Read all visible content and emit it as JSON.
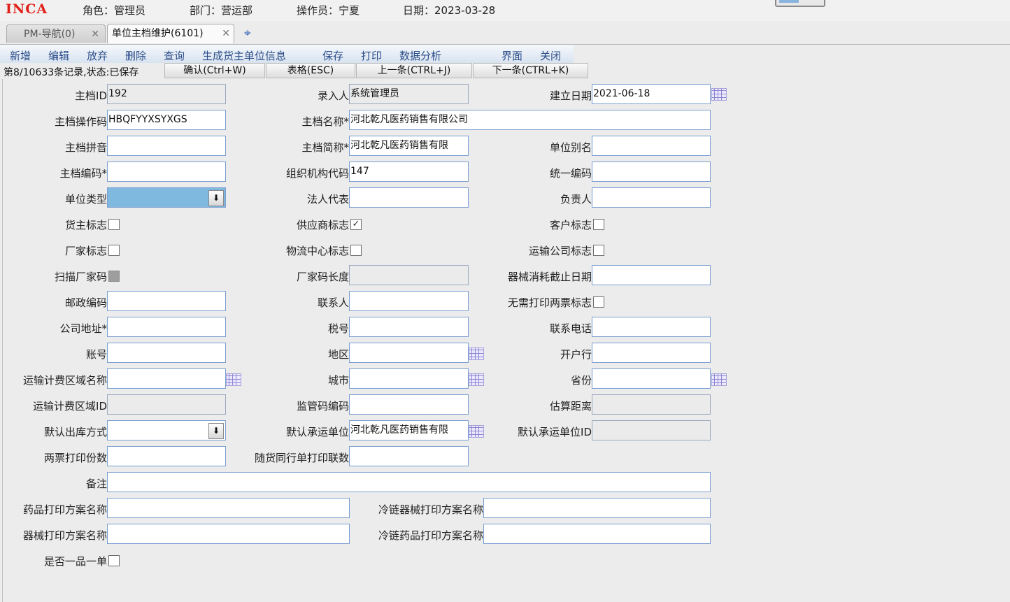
{
  "header": {
    "logo": "INCA",
    "role": "角色：管理员",
    "dept": "部门：营运部",
    "operator": "操作员：宁夏",
    "date": "日期：2023-03-28"
  },
  "tabs": [
    {
      "label": "PM-导航(0)",
      "close": "✕"
    },
    {
      "label": "单位主档维护(6101)",
      "close": "✕"
    }
  ],
  "tab_add_icon": "plus-icon",
  "menu": [
    "新增",
    "编辑",
    "放弃",
    "删除",
    "查询",
    "生成货主单位信息",
    "保存",
    "打印",
    "数据分析",
    "界面",
    "关闭"
  ],
  "status": {
    "text": "第8/10633条记录,状态:已保存",
    "buttons": [
      "确认(Ctrl+W)",
      "表格(ESC)",
      "上一条(CTRL+J)",
      "下一条(CTRL+K)"
    ]
  },
  "form": {
    "labels": {
      "master_id": "主档ID",
      "creator": "录入人",
      "create_date": "建立日期",
      "op_code": "主档操作码",
      "name": "主档名称*",
      "pinyin": "主档拼音",
      "short_name": "主档简称*",
      "alias": "单位别名",
      "code": "主档编码*",
      "org_code": "组织机构代码",
      "unified_code": "统一编码",
      "unit_type": "单位类型",
      "legal_rep": "法人代表",
      "manager": "负责人",
      "owner_flag": "货主标志",
      "supplier_flag": "供应商标志",
      "customer_flag": "客户标志",
      "mfr_flag": "厂家标志",
      "logistics_flag": "物流中心标志",
      "transport_flag": "运输公司标志",
      "scan_mfr_code": "扫描厂家码",
      "mfr_code_len": "厂家码长度",
      "device_expiry": "器械消耗截止日期",
      "postal_code": "邮政编码",
      "contact": "联系人",
      "no_print_two_invoices": "无需打印两票标志",
      "address": "公司地址*",
      "tax_no": "税号",
      "phone": "联系电话",
      "account": "账号",
      "region": "地区",
      "bank": "开户行",
      "freight_zone_name": "运输计费区域名称",
      "city": "城市",
      "province": "省份",
      "freight_zone_id": "运输计费区域ID",
      "regulatory_code": "监管码编码",
      "est_distance": "估算距离",
      "default_outbound": "默认出库方式",
      "default_carrier": "默认承运单位",
      "default_carrier_id": "默认承运单位ID",
      "two_invoice_copies": "两票打印份数",
      "accompany_copies": "随货同行单打印联数",
      "remark": "备注",
      "drug_print_plan": "药品打印方案名称",
      "cold_device_print_plan": "冷链器械打印方案名称",
      "device_print_plan": "器械打印方案名称",
      "cold_drug_print_plan": "冷链药品打印方案名称",
      "one_item_one_order": "是否一品一单"
    },
    "values": {
      "master_id": "192",
      "creator": "系统管理员",
      "create_date": "2021-06-18",
      "op_code": "HBQFYYXSYXGS",
      "name": "河北乾凡医药销售有限公司",
      "short_name": "河北乾凡医药销售有限",
      "org_code": "147",
      "default_carrier": "河北乾凡医药销售有限"
    },
    "checkboxes": {
      "owner_flag": "",
      "supplier_flag": "✓",
      "customer_flag": "",
      "mfr_flag": "",
      "logistics_flag": "",
      "transport_flag": "",
      "no_print_two_invoices": "",
      "one_item_one_order": ""
    },
    "dropdown_glyph": "⬇"
  }
}
